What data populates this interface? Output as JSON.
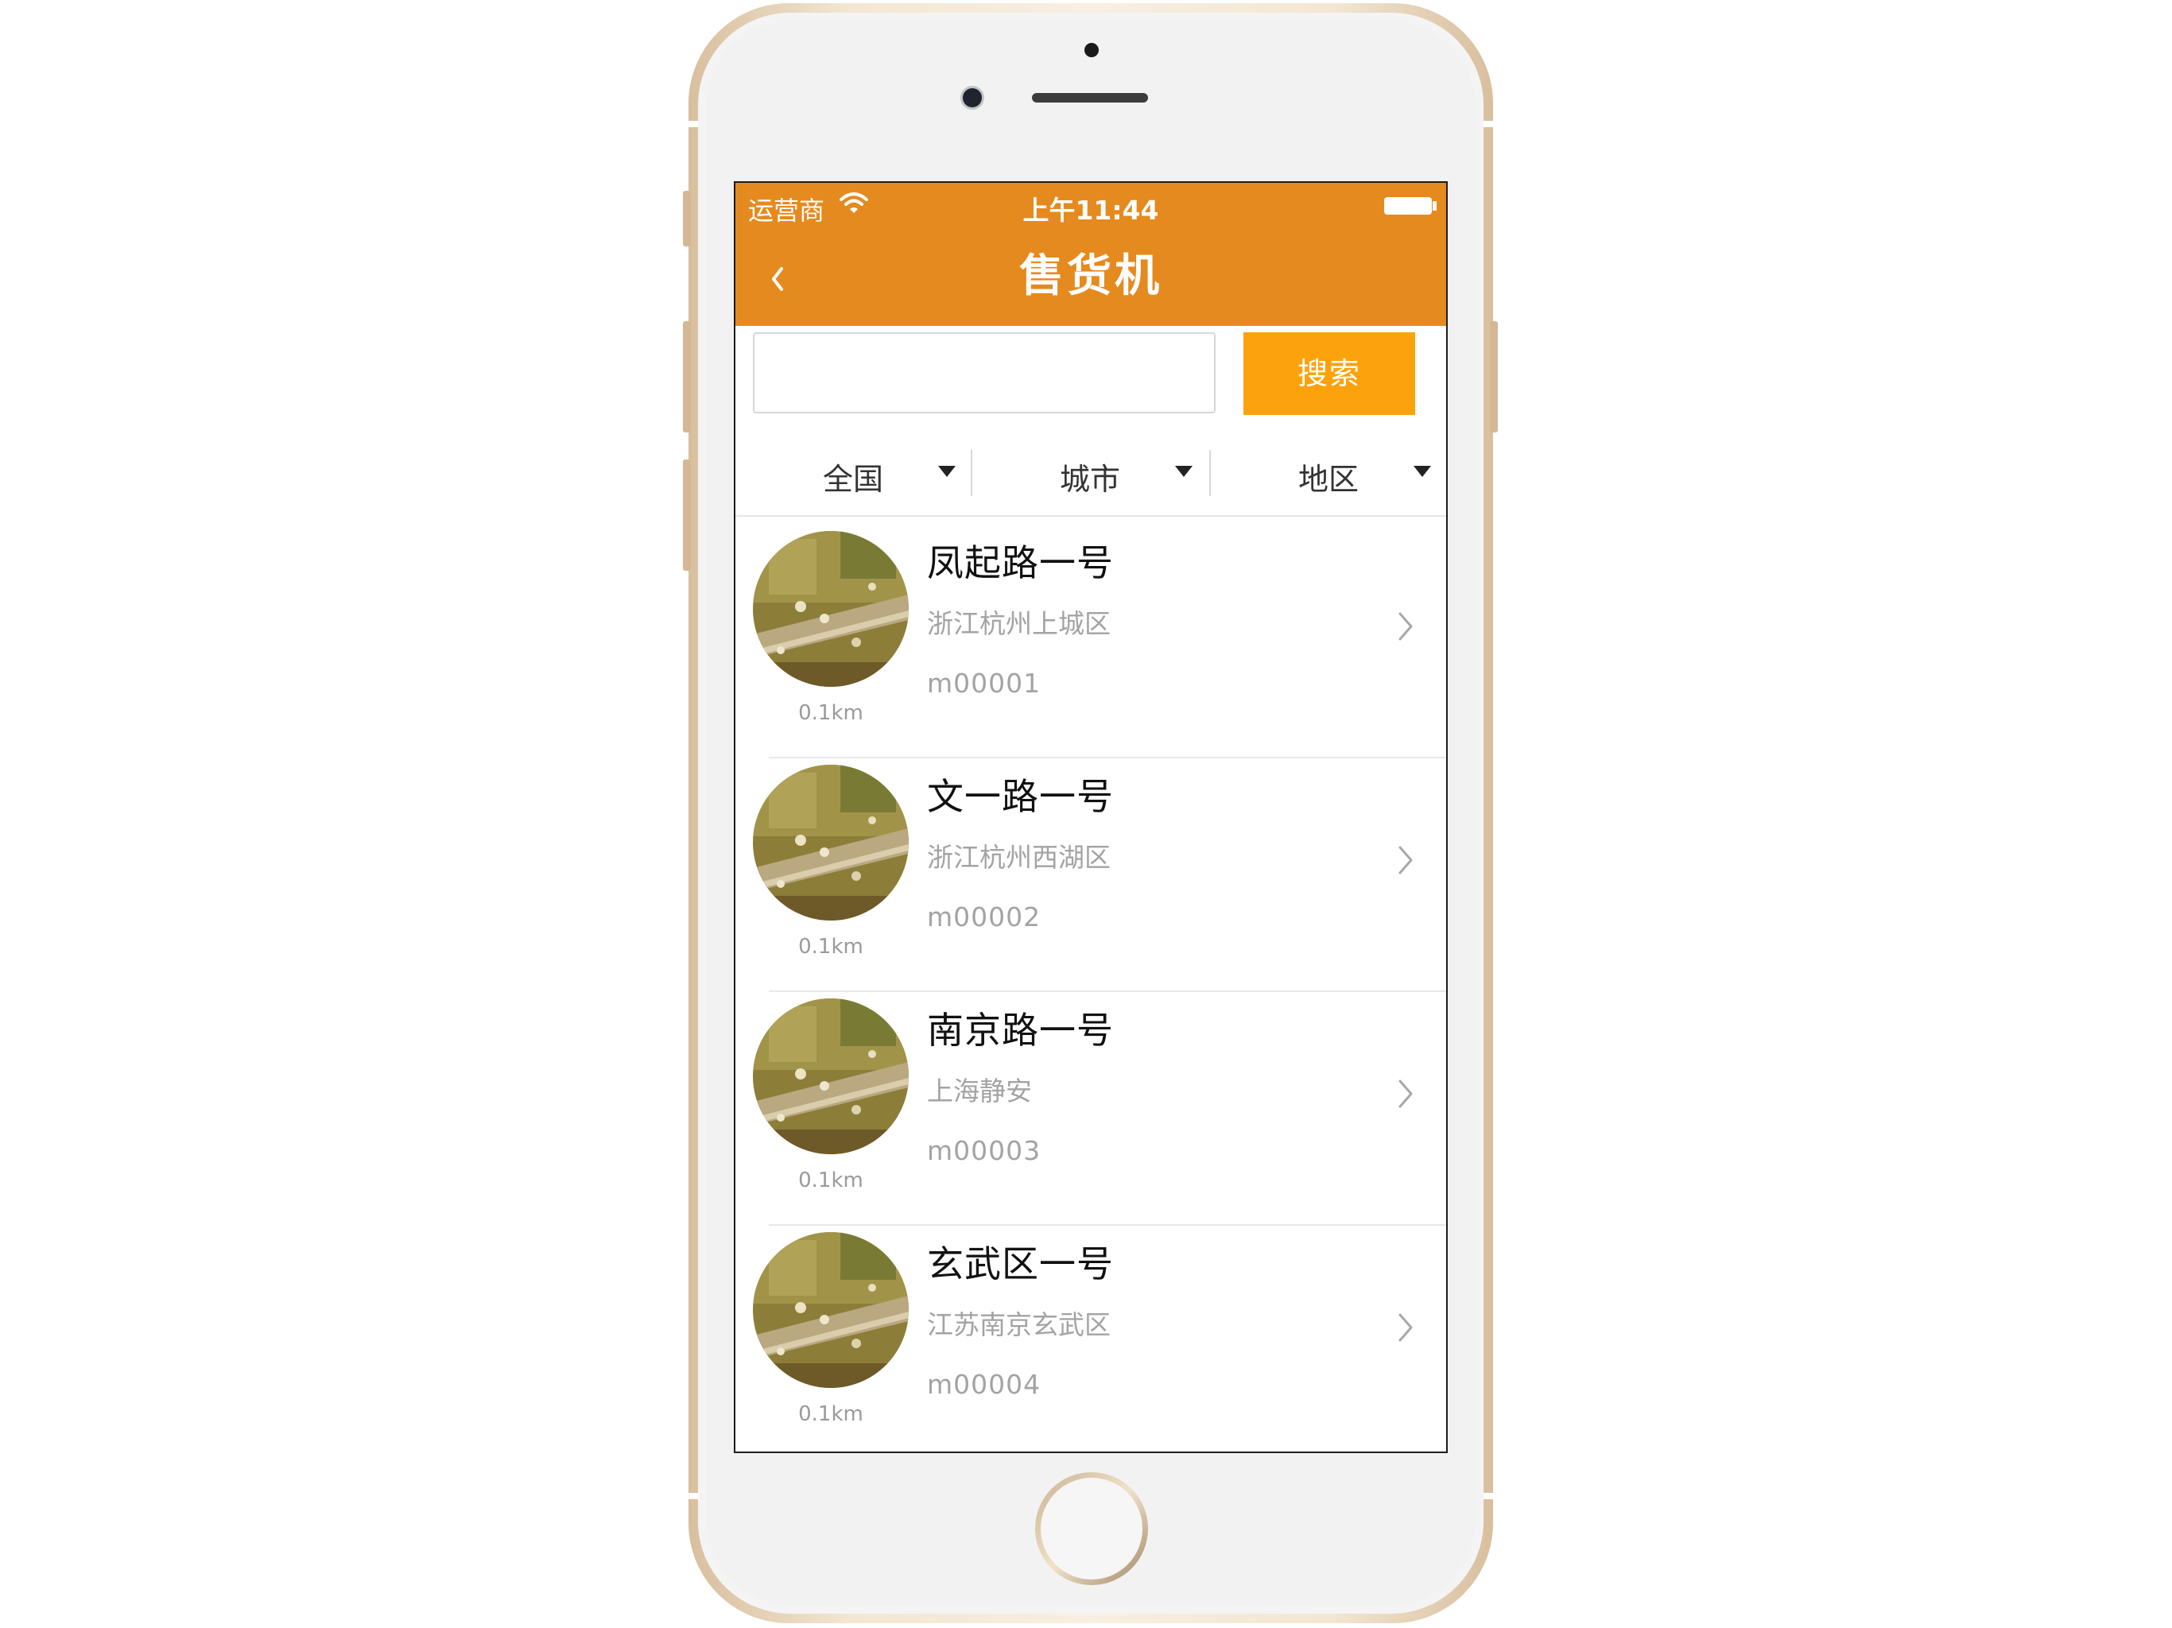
{
  "status_bar": {
    "carrier": "运营商",
    "time": "上午11:44"
  },
  "nav": {
    "title": "售货机",
    "back_icon": "chevron-left-icon"
  },
  "search": {
    "placeholder": "",
    "button_label": "搜索"
  },
  "filters": [
    {
      "label": "全国"
    },
    {
      "label": "城市"
    },
    {
      "label": "地区"
    }
  ],
  "machines": [
    {
      "name": "凤起路一号",
      "address": "浙江杭州上城区",
      "code": "m00001",
      "distance": "0.1km"
    },
    {
      "name": "文一路一号",
      "address": "浙江杭州西湖区",
      "code": "m00002",
      "distance": "0.1km"
    },
    {
      "name": "南京路一号",
      "address": "上海静安",
      "code": "m00003",
      "distance": "0.1km"
    },
    {
      "name": "玄武区一号",
      "address": "江苏南京玄武区",
      "code": "m00004",
      "distance": "0.1km"
    }
  ],
  "colors": {
    "header": "#e58a1e",
    "search_button": "#fca20d",
    "secondary_text": "#a3a3a3"
  }
}
